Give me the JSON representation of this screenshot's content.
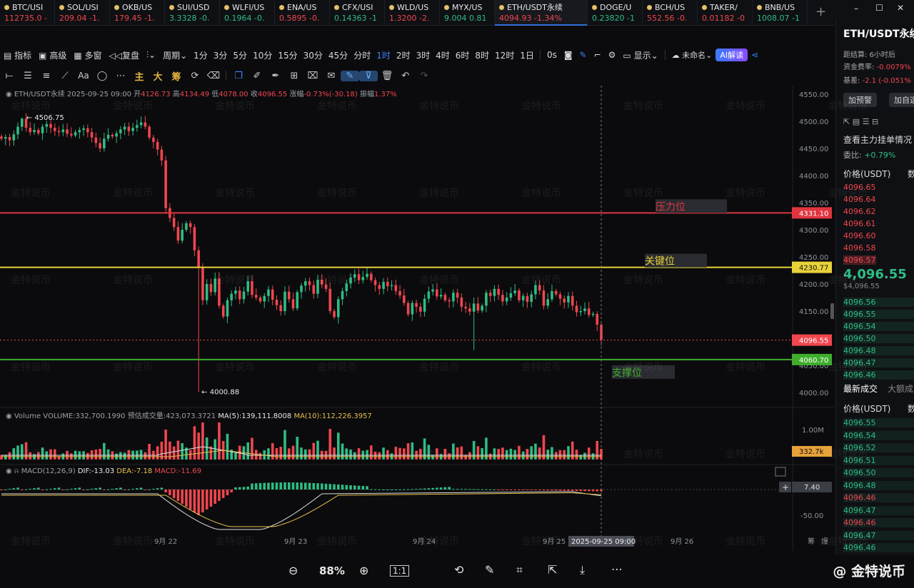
{
  "tabs": [
    {
      "name": "BTC/USI",
      "price": "112735.0",
      "chg": "-",
      "dir": "dn"
    },
    {
      "name": "SOL/USI",
      "price": "209.04",
      "chg": "-1.",
      "dir": "dn"
    },
    {
      "name": "OKB/US",
      "price": "179.45",
      "chg": "-1.",
      "dir": "dn"
    },
    {
      "name": "SUI/USD",
      "price": "3.3328",
      "chg": "-0.",
      "dir": "up"
    },
    {
      "name": "WLFI/US",
      "price": "0.1964",
      "chg": "-0.",
      "dir": "up"
    },
    {
      "name": "ENA/US",
      "price": "0.5895",
      "chg": "-0.",
      "dir": "dn"
    },
    {
      "name": "CFX/USI",
      "price": "0.14363",
      "chg": "-1",
      "dir": "up"
    },
    {
      "name": "WLD/US",
      "price": "1.3200",
      "chg": "-2.",
      "dir": "dn"
    },
    {
      "name": "MYX/US",
      "price": "9.004",
      "chg": "0.81",
      "dir": "up"
    }
  ],
  "active_tab": {
    "name": "ETH/USDT永续",
    "price": "4094.93",
    "chg": "-1.34%"
  },
  "tabs_right": [
    {
      "name": "DOGE/U",
      "price": "0.23820",
      "chg": "-1",
      "dir": "up"
    },
    {
      "name": "BCH/US",
      "price": "552.56",
      "chg": "-0.",
      "dir": "dn"
    },
    {
      "name": "TAKER/",
      "price": "0.01182",
      "chg": "-0",
      "dir": "dn"
    },
    {
      "name": "BNB/US",
      "price": "1008.07",
      "chg": "-1",
      "dir": "up"
    }
  ],
  "toolbar": {
    "indicator": "指标",
    "advanced": "高级",
    "multi": "多窗",
    "replay": "复盘",
    "period": "周期",
    "intervals": [
      "1分",
      "3分",
      "5分",
      "10分",
      "15分",
      "30分",
      "45分",
      "分时",
      "1时",
      "2时",
      "3时",
      "4时",
      "6时",
      "8时",
      "12时",
      "1日"
    ],
    "active_interval": "1时",
    "zero_s": "0s",
    "display": "显示",
    "unnamed": "未命名",
    "ai": "AI解读"
  },
  "drawbar": {
    "zhu": "主",
    "da": "大",
    "chou": "筹",
    "aa": "Aa"
  },
  "info": {
    "symbol": "ETH/USDT永续",
    "time": "2025-09-25 09:00",
    "open_l": "开",
    "open": "4126.73",
    "high_l": "高",
    "high": "4134.49",
    "low_l": "低",
    "low": "4078.00",
    "close_l": "收",
    "close": "4096.55",
    "chg_l": "涨幅",
    "chg": "-0.73%(-30.18)",
    "amp_l": "振幅",
    "amp": "1.37%"
  },
  "volume": {
    "label": "Volume",
    "vol": "VOLUME:332,700.1990",
    "pred": "预估成交量:423,073.3721",
    "ma5": "MA(5):139,111.8008",
    "ma10": "MA(10):112,226.3957",
    "axis_1m": "1.00M",
    "last_tag": "332.7k"
  },
  "macd": {
    "label": "MACD(12,26,9)",
    "dif": "DIF:-13.03",
    "dea": "DEA:-7.18",
    "macd": "MACD:-11.69",
    "tag": "7.40",
    "axis_neg": "-50.00"
  },
  "annotations": {
    "resistance": "压力位",
    "key": "关键位",
    "support": "支撑位",
    "high_label": "4506.75",
    "low_label": "4000.88",
    "cursor_time": "2025-09-25 09:00"
  },
  "colors": {
    "up": "#2ebd85",
    "down": "#f0464e",
    "resistance": "#e0353f",
    "key": "#e8d23a",
    "support": "#3fae2c",
    "bg": "#0b0b0d"
  },
  "right_panel": {
    "symbol": "ETH/USDT永续",
    "settle": "距结算:",
    "settle_v": "6小时后",
    "funding": "资金费率:",
    "funding_v": "-0.0079%",
    "basis": "基差:",
    "basis_v": "-2.1 (-0.051%",
    "alert": "加预警",
    "add": "加自选",
    "depth_title": "查看主力挂单情况",
    "ratio_l": "委比:",
    "ratio": "+0.79%",
    "price_h": "价格(USDT)",
    "qty_h": "数",
    "asks": [
      "4096.65",
      "4096.64",
      "4096.62",
      "4096.61",
      "4096.60",
      "4096.58",
      "4096.57"
    ],
    "last": "4,096.55",
    "last_sub": "$4,096.55",
    "bids": [
      "4096.56",
      "4096.55",
      "4096.54",
      "4096.50",
      "4096.48",
      "4096.47",
      "4096.46"
    ],
    "trades_title": "最新成交",
    "big_trades": "大额成",
    "trades": [
      {
        "p": "4096.55",
        "d": "up"
      },
      {
        "p": "4096.54",
        "d": "up"
      },
      {
        "p": "4096.52",
        "d": "up"
      },
      {
        "p": "4096.51",
        "d": "up"
      },
      {
        "p": "4096.50",
        "d": "up"
      },
      {
        "p": "4096.48",
        "d": "up"
      },
      {
        "p": "4096.46",
        "d": "dn"
      },
      {
        "p": "4096.47",
        "d": "up"
      },
      {
        "p": "4096.46",
        "d": "dn"
      },
      {
        "p": "4096.47",
        "d": "up"
      },
      {
        "p": "4096.46",
        "d": "up"
      }
    ]
  },
  "bottom": {
    "zoom": "88%",
    "brand": "@ 金特说币",
    "ratio": "1:1"
  },
  "watermark": "金特说币",
  "x_axis": {
    "labels": [
      "9月 22",
      "9月 23",
      "9月 24",
      "9月 25",
      "9月 26"
    ],
    "right_a": "筹",
    "right_b": "爆"
  },
  "chart_data": {
    "type": "candlestick",
    "interval": "1h",
    "ylim": [
      4000,
      4550
    ],
    "yticks": [
      4550,
      4500,
      4450,
      4400,
      4350,
      4300,
      4250,
      4200,
      4150,
      4100,
      4050,
      4000
    ],
    "levels": [
      {
        "label": "压力位",
        "value": 4331.1
      },
      {
        "label": "关键位",
        "value": 4230.77
      },
      {
        "label": "支撑位",
        "value": 4060.7
      }
    ],
    "last_price": 4096.55,
    "extremes": {
      "high": 4506.75,
      "low": 4000.88
    },
    "closes": [
      4468,
      4471,
      4465,
      4476,
      4490,
      4505,
      4488,
      4480,
      4484,
      4478,
      4490,
      4495,
      4488,
      4482,
      4480,
      4485,
      4477,
      4474,
      4480,
      4484,
      4487,
      4480,
      4470,
      4460,
      4450,
      4468,
      4475,
      4472,
      4478,
      4485,
      4490,
      4482,
      4488,
      4493,
      4498,
      4490,
      4470,
      4462,
      4448,
      4428,
      4340,
      4322,
      4305,
      4280,
      4300,
      4312,
      4305,
      4262,
      4230,
      4170,
      4200,
      4185,
      4210,
      4160,
      4140,
      4170,
      4182,
      4188,
      4172,
      4186,
      4205,
      4180,
      4175,
      4168,
      4178,
      4190,
      4171,
      4161,
      4150,
      4186,
      4172,
      4155,
      4185,
      4197,
      4205,
      4198,
      4182,
      4208,
      4199,
      4191,
      4150,
      4139,
      4172,
      4187,
      4201,
      4212,
      4218,
      4207,
      4213,
      4219,
      4207,
      4198,
      4191,
      4204,
      4196,
      4198,
      4187,
      4179,
      4165,
      4144,
      4165,
      4158,
      4149,
      4173,
      4186,
      4190,
      4177,
      4180,
      4170,
      4168,
      4184,
      4175,
      4158,
      4155,
      4149,
      4164,
      4151,
      4160,
      4184,
      4178,
      4191,
      4180,
      4168,
      4175,
      4183,
      4188,
      4170,
      4178,
      4167,
      4181,
      4198,
      4188,
      4160,
      4172,
      4187,
      4181,
      4173,
      4166,
      4178,
      4160,
      4148,
      4150,
      4155,
      4143,
      4145,
      4125,
      4097
    ],
    "volume_ma5_last": 139111.8,
    "macd_last": {
      "dif": -13.03,
      "dea": -7.18,
      "hist": -11.69
    }
  }
}
